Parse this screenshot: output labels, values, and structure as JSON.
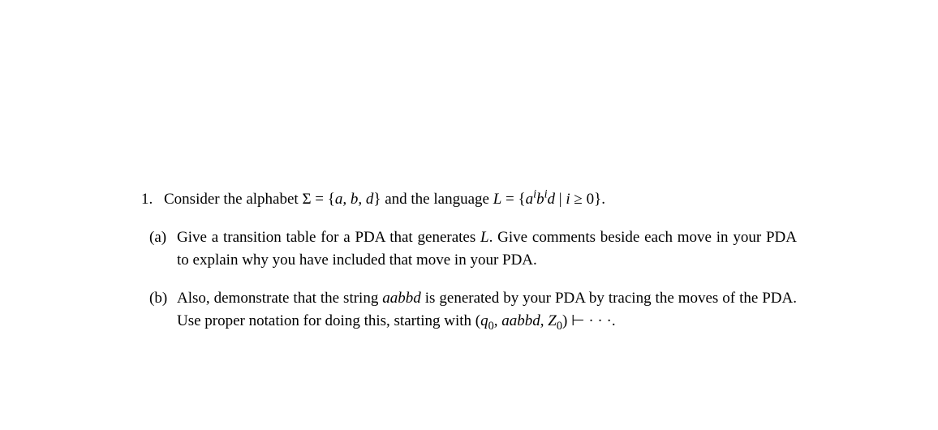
{
  "problem": {
    "number": "1.",
    "intro_part1": "Consider the alphabet ",
    "sigma_eq": "Σ = {",
    "alphabet": "a, b, d",
    "intro_part2": "} and the language ",
    "L_eq": "L",
    "equals": " = {",
    "lang_a": "a",
    "lang_exp_i1": "i",
    "lang_b": "b",
    "lang_exp_i2": "i",
    "lang_d": "d",
    "lang_cond": " | ",
    "lang_i": "i",
    "lang_geq": " ≥ 0}.",
    "parts": {
      "a": {
        "label": "(a)",
        "text_part1": "Give a transition table for a PDA that generates ",
        "L_ref": "L",
        "text_part2": ". Give comments beside each move in your PDA to explain why you have included that move in your PDA."
      },
      "b": {
        "label": "(b)",
        "text_part1": "Also, demonstrate that the string ",
        "string": "aabbd",
        "text_part2": " is generated by your PDA by tracing the moves of the PDA. Use proper notation for doing this, starting with (",
        "q0": "q",
        "q0_sub": "0",
        "comma1": ", ",
        "aabbd": "aabbd",
        "comma2": ", ",
        "Z": "Z",
        "Z_sub": "0",
        "closing": ") ⊢ · · ·."
      }
    }
  }
}
